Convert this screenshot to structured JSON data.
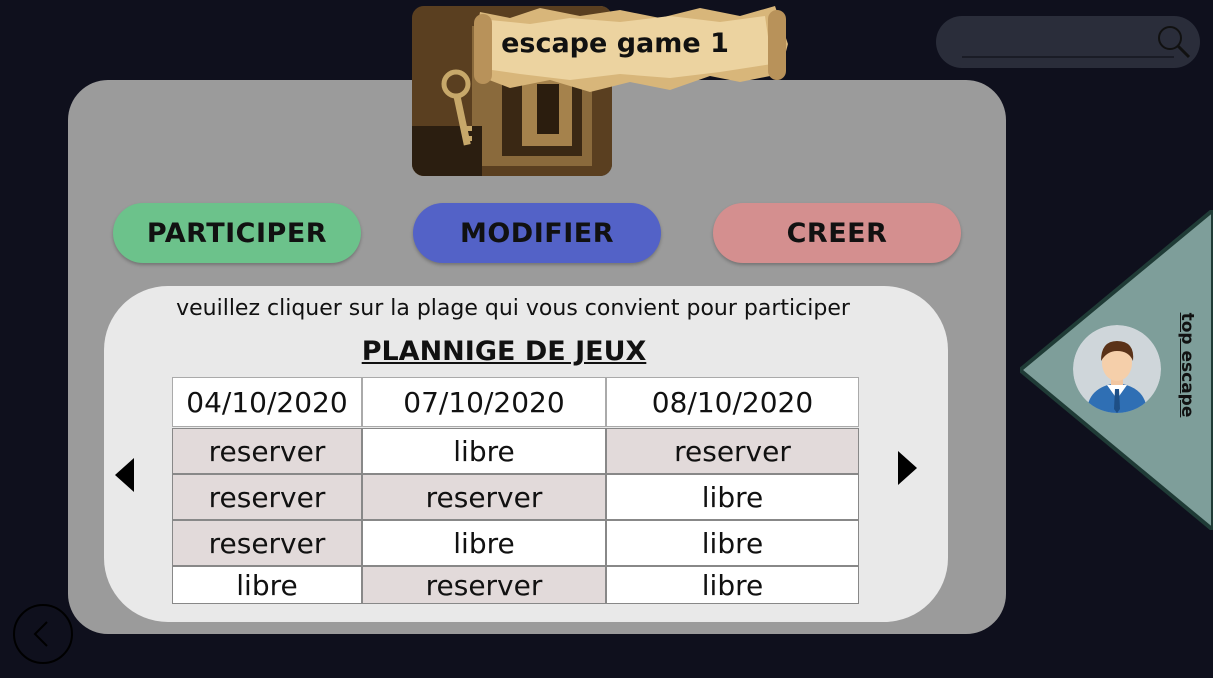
{
  "header": {
    "game_title": "escape game 1"
  },
  "buttons": {
    "participer": "PARTICIPER",
    "modifier": "MODIFIER",
    "creer": "CREER"
  },
  "planning": {
    "instruction": "veuillez cliquer sur la plage qui vous convient pour participer",
    "title": "PLANNIGE DE JEUX",
    "dates": [
      "04/10/2020",
      "07/10/2020",
      "08/10/2020"
    ],
    "columns": [
      [
        "reserver",
        "reserver",
        "reserver",
        "libre"
      ],
      [
        "libre",
        "reserver",
        "libre",
        "reserver"
      ],
      [
        "reserver",
        "libre",
        "libre",
        "libre"
      ]
    ]
  },
  "sidebar": {
    "label": "top escape"
  },
  "icons": [
    "search-icon",
    "chevron-left-icon",
    "chevron-right-icon",
    "back-icon",
    "avatar"
  ],
  "colors": {
    "background": "#0f101d",
    "panel": "#9b9b9b",
    "participer": "#6cc28b",
    "modifier": "#5362c7",
    "creer": "#d48f8f",
    "reserved_cell": "#e2dada",
    "sidebar": "#7e9e9a"
  }
}
